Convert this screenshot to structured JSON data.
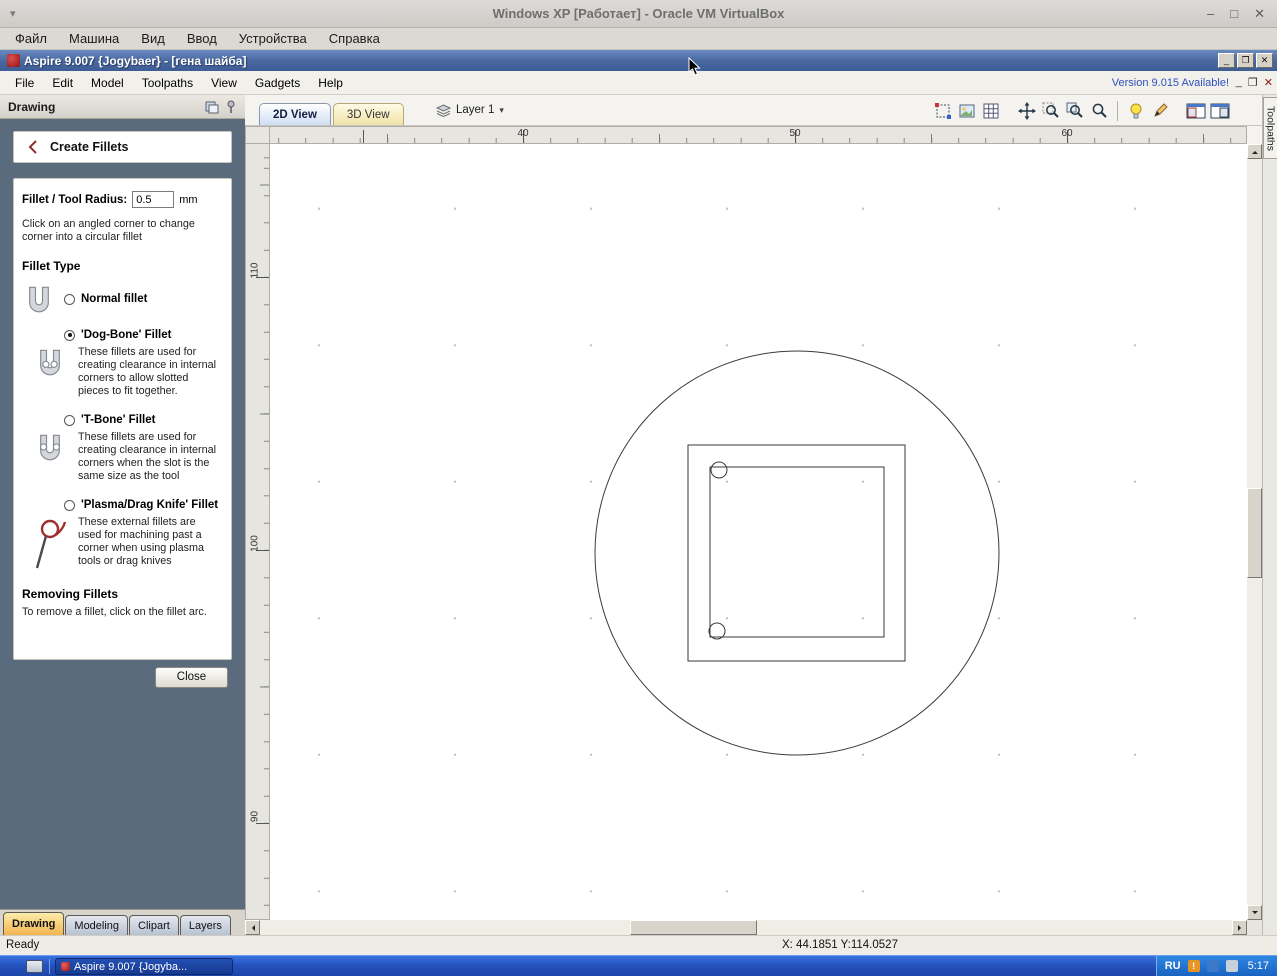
{
  "vbox": {
    "title": "Windows XP [Работает] - Oracle VM VirtualBox",
    "menu": [
      "Файл",
      "Машина",
      "Вид",
      "Ввод",
      "Устройства",
      "Справка"
    ]
  },
  "xp": {
    "title": "Aspire 9.007 {Jogybaer} - [гена шайба]"
  },
  "app": {
    "menu": [
      "File",
      "Edit",
      "Model",
      "Toolpaths",
      "View",
      "Gadgets",
      "Help"
    ],
    "version_link": "Version 9.015 Available!"
  },
  "icons": {
    "minimize": "–",
    "maximize": "□",
    "restore": "❐",
    "close": "✕",
    "chevron_down": "▾",
    "mdi_minimize": "_"
  },
  "panel": {
    "title": "Drawing",
    "header": "Create Fillets",
    "radius_label": "Fillet / Tool Radius:",
    "radius_value": "0.5",
    "radius_unit": "mm",
    "instruction": "Click on an angled corner to change corner into a circular fillet",
    "fillet_type_heading": "Fillet Type",
    "options": [
      {
        "label": "Normal fillet",
        "selected": false,
        "description": ""
      },
      {
        "label": "'Dog-Bone' Fillet",
        "selected": true,
        "description": "These fillets are used for creating clearance in internal corners to allow slotted pieces to fit together."
      },
      {
        "label": "'T-Bone' Fillet",
        "selected": false,
        "description": "These fillets are used for creating clearance in internal corners when the slot is the same size as the tool"
      },
      {
        "label": "'Plasma/Drag Knife' Fillet",
        "selected": false,
        "description": "These external fillets are used for machining past a corner when using plasma tools or drag knives"
      }
    ],
    "removing_heading": "Removing Fillets",
    "removing_note": "To remove a fillet, click on the fillet arc.",
    "close_label": "Close",
    "tabs": [
      "Drawing",
      "Modeling",
      "Clipart",
      "Layers"
    ]
  },
  "canvas": {
    "view_tabs": [
      "2D View",
      "3D View"
    ],
    "layer_selector": "Layer 1",
    "ruler_h": [
      "40",
      "50",
      "60"
    ],
    "ruler_v": [
      "110",
      "100",
      "90"
    ],
    "toolpaths_tab": "Toolpaths",
    "toolbar_icon_names": [
      "snap-settings",
      "bitmap-visibility",
      "grid-visibility",
      "pan-view",
      "zoom-box",
      "zoom-selection",
      "zoom-extents",
      "toggle-shading",
      "edit-vectors",
      "layout-2d-3d-split",
      "layout-2d-3d-windows"
    ]
  },
  "status": {
    "ready": "Ready",
    "coords": "X: 44.1851 Y:114.0527"
  },
  "taskbar": {
    "task_label": "Aspire 9.007 {Jogyba...",
    "lang": "RU",
    "time": "5:17"
  }
}
